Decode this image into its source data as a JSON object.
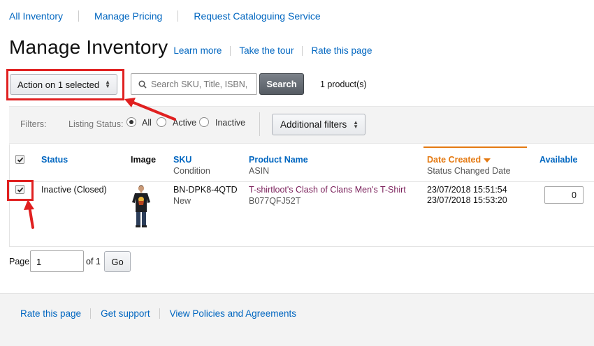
{
  "top_nav": {
    "items": [
      "All Inventory",
      "Manage Pricing",
      "Request Cataloguing Service"
    ]
  },
  "page": {
    "title": "Manage Inventory",
    "links": [
      "Learn more",
      "Take the tour",
      "Rate this page"
    ]
  },
  "toolbar": {
    "action_label": "Action on 1 selected",
    "search_placeholder": "Search SKU, Title, ISBN,",
    "search_label": "Search",
    "product_count": "1 product(s)"
  },
  "filters": {
    "label": "Filters:",
    "status_label": "Listing Status:",
    "options": [
      "All",
      "Active",
      "Inactive"
    ],
    "selected": "All",
    "additional_label": "Additional filters"
  },
  "table": {
    "columns": {
      "status": "Status",
      "image": "Image",
      "sku": "SKU",
      "sku_sub": "Condition",
      "product": "Product Name",
      "product_sub": "ASIN",
      "date": "Date Created",
      "date_sub": "Status Changed Date",
      "available": "Available"
    },
    "rows": [
      {
        "status": "Inactive (Closed)",
        "sku": "BN-DPK8-4QTD",
        "condition": "New",
        "product_name": "T-shirtloot's Clash of Clans Men's T-Shirt",
        "asin": "B077QFJ52T",
        "date_created": "23/07/2018 15:51:54",
        "status_changed": "23/07/2018 15:53:20",
        "available": "0",
        "image": "tshirt-thumbnail"
      }
    ]
  },
  "pagination": {
    "page_label": "Page",
    "page_value": "1",
    "of_label": "of 1",
    "go_label": "Go"
  },
  "footer": {
    "links": [
      "Rate this page",
      "Get support",
      "View Policies and Agreements"
    ]
  },
  "colors": {
    "link": "#0066c0",
    "sort_accent": "#e47911",
    "highlight": "#e02020",
    "product_link": "#7a1f5a"
  }
}
